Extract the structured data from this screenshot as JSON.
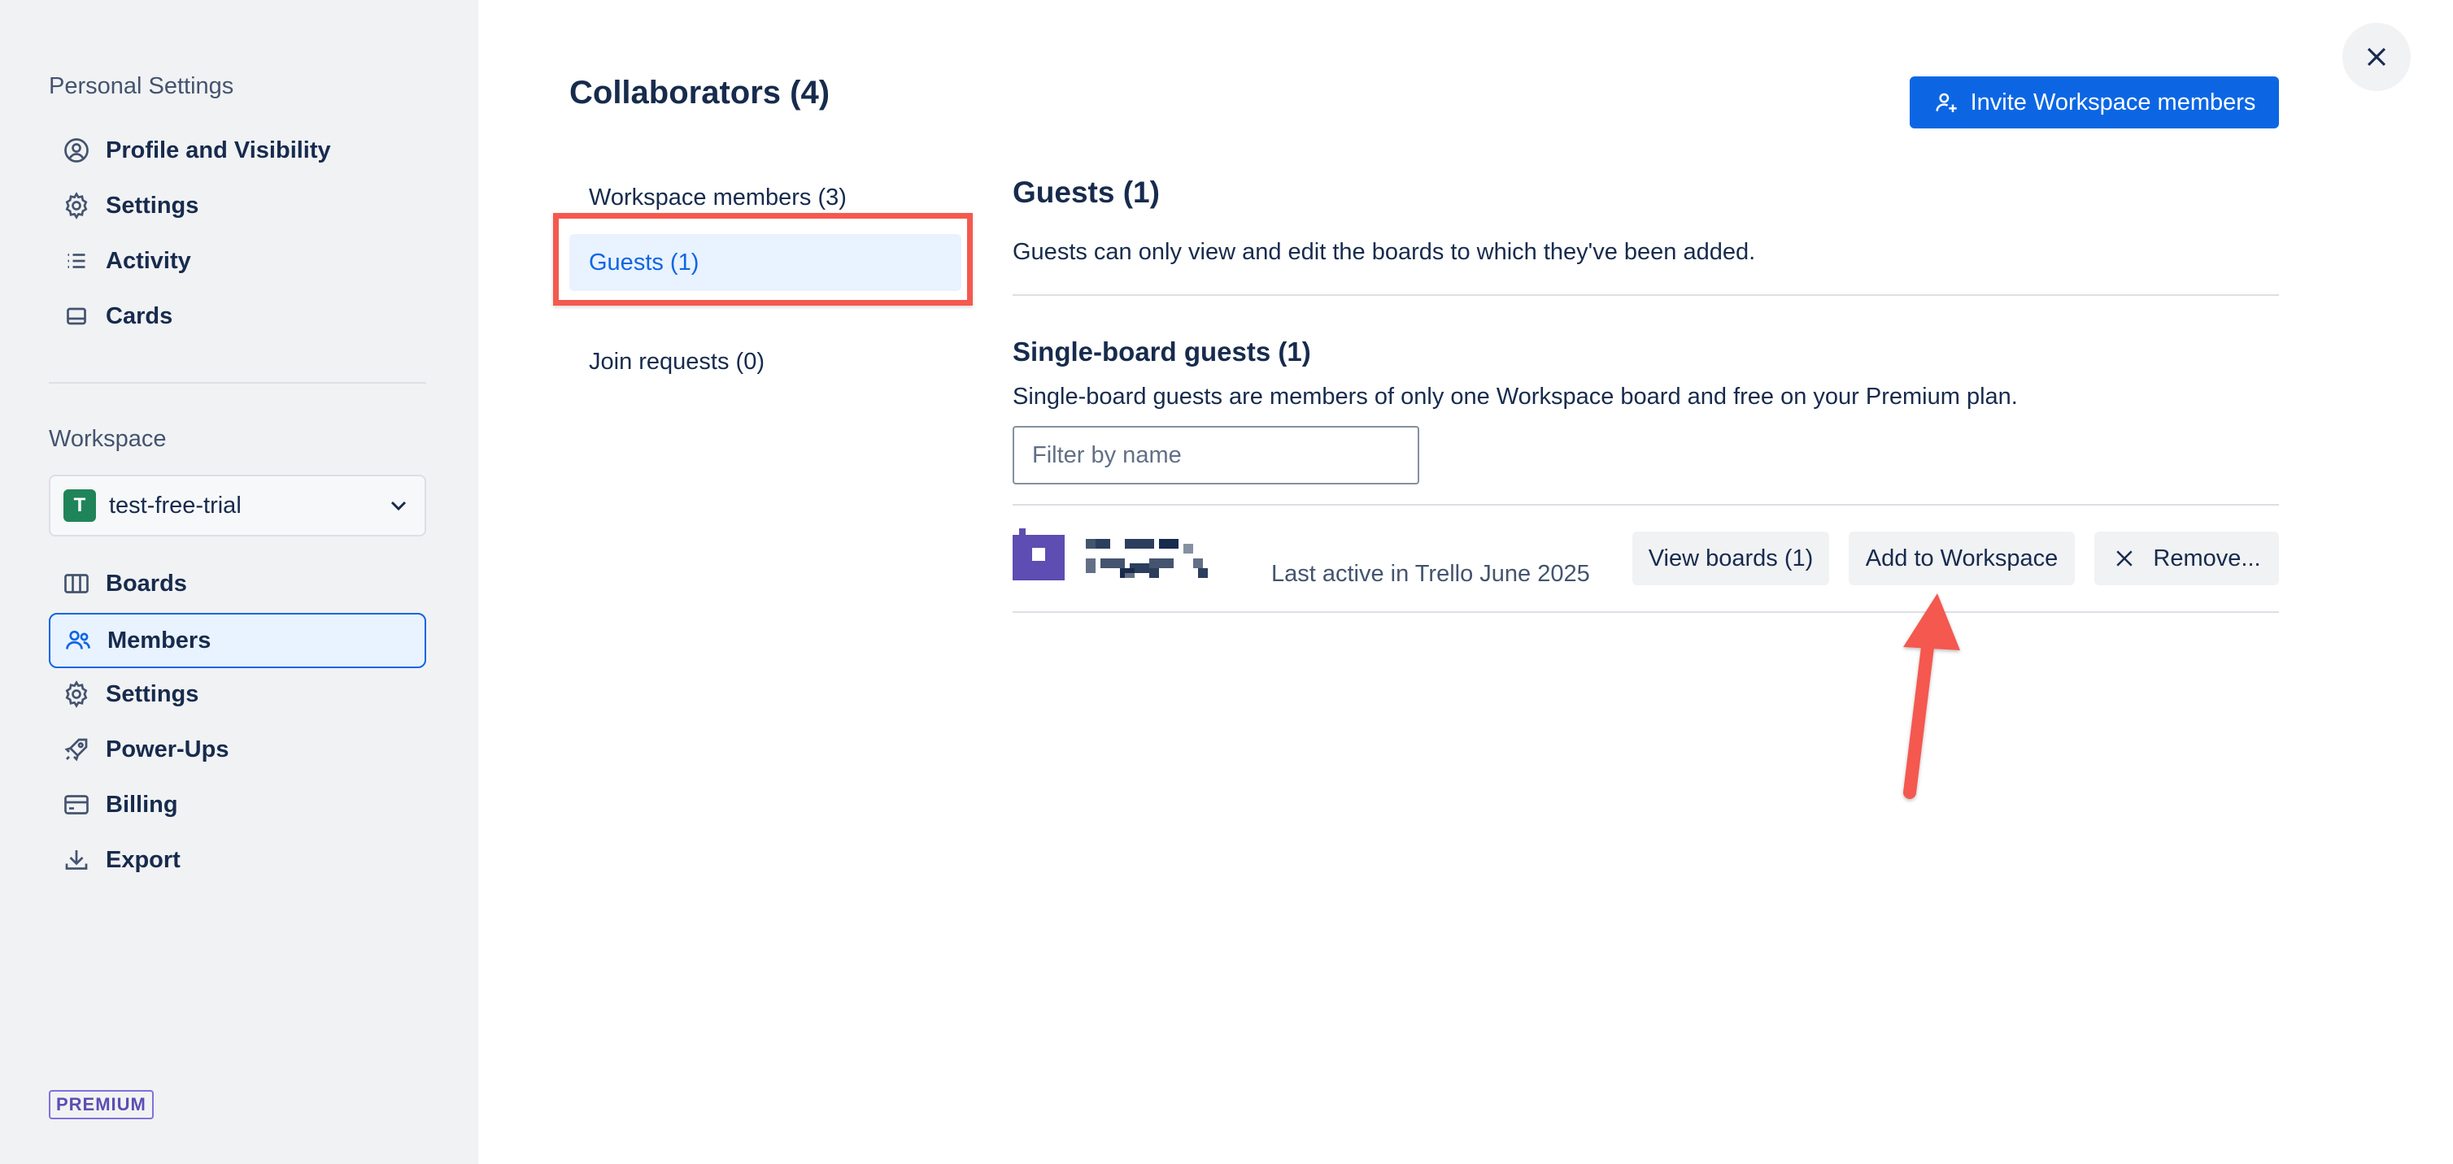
{
  "sidebar": {
    "personal_heading": "Personal Settings",
    "personal_items": [
      {
        "label": "Profile and Visibility",
        "icon": "user-circle-icon"
      },
      {
        "label": "Settings",
        "icon": "gear-icon"
      },
      {
        "label": "Activity",
        "icon": "list-icon"
      },
      {
        "label": "Cards",
        "icon": "card-icon"
      }
    ],
    "workspace_heading": "Workspace",
    "workspace_selector": {
      "logo_letter": "T",
      "name": "test-free-trial"
    },
    "workspace_items": [
      {
        "label": "Boards",
        "icon": "boards-icon"
      },
      {
        "label": "Members",
        "icon": "members-icon",
        "active": true
      },
      {
        "label": "Settings",
        "icon": "gear-icon"
      },
      {
        "label": "Power-Ups",
        "icon": "rocket-icon"
      },
      {
        "label": "Billing",
        "icon": "credit-card-icon"
      },
      {
        "label": "Export",
        "icon": "download-icon"
      }
    ],
    "badge": "PREMIUM"
  },
  "main": {
    "title": "Collaborators (4)",
    "invite_button": "Invite Workspace members",
    "tabs": [
      {
        "label": "Workspace members (3)"
      },
      {
        "label": "Guests (1)",
        "active": true
      },
      {
        "label": "Join requests (0)"
      }
    ],
    "guests_heading": "Guests (1)",
    "guests_description": "Guests can only view and edit the boards to which they've been added.",
    "single_board_heading": "Single-board guests (1)",
    "single_board_description": "Single-board guests are members of only one Workspace board and free on your Premium plan.",
    "filter_placeholder": "Filter by name",
    "guest": {
      "last_active": "Last active in Trello June 2025",
      "view_boards": "View boards (1)",
      "add_to_workspace": "Add to Workspace",
      "remove": "Remove..."
    }
  },
  "colors": {
    "accent": "#0c66e4",
    "annotation": "#f4594f",
    "premium": "#5e4db2",
    "workspace_logo": "#1f845a"
  }
}
